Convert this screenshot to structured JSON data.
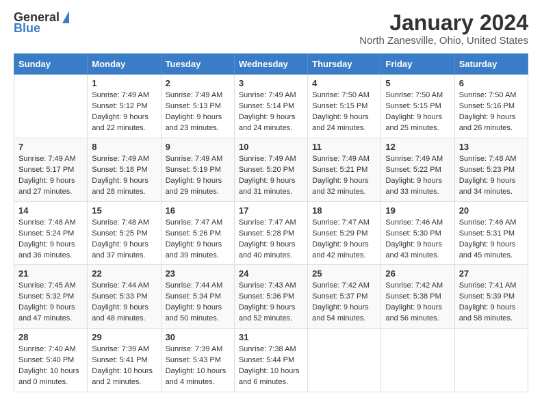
{
  "logo": {
    "general": "General",
    "blue": "Blue"
  },
  "title": "January 2024",
  "location": "North Zanesville, Ohio, United States",
  "days_of_week": [
    "Sunday",
    "Monday",
    "Tuesday",
    "Wednesday",
    "Thursday",
    "Friday",
    "Saturday"
  ],
  "weeks": [
    [
      {
        "day": "",
        "details": ""
      },
      {
        "day": "1",
        "details": "Sunrise: 7:49 AM\nSunset: 5:12 PM\nDaylight: 9 hours\nand 22 minutes."
      },
      {
        "day": "2",
        "details": "Sunrise: 7:49 AM\nSunset: 5:13 PM\nDaylight: 9 hours\nand 23 minutes."
      },
      {
        "day": "3",
        "details": "Sunrise: 7:49 AM\nSunset: 5:14 PM\nDaylight: 9 hours\nand 24 minutes."
      },
      {
        "day": "4",
        "details": "Sunrise: 7:50 AM\nSunset: 5:15 PM\nDaylight: 9 hours\nand 24 minutes."
      },
      {
        "day": "5",
        "details": "Sunrise: 7:50 AM\nSunset: 5:15 PM\nDaylight: 9 hours\nand 25 minutes."
      },
      {
        "day": "6",
        "details": "Sunrise: 7:50 AM\nSunset: 5:16 PM\nDaylight: 9 hours\nand 26 minutes."
      }
    ],
    [
      {
        "day": "7",
        "details": "Sunrise: 7:49 AM\nSunset: 5:17 PM\nDaylight: 9 hours\nand 27 minutes."
      },
      {
        "day": "8",
        "details": "Sunrise: 7:49 AM\nSunset: 5:18 PM\nDaylight: 9 hours\nand 28 minutes."
      },
      {
        "day": "9",
        "details": "Sunrise: 7:49 AM\nSunset: 5:19 PM\nDaylight: 9 hours\nand 29 minutes."
      },
      {
        "day": "10",
        "details": "Sunrise: 7:49 AM\nSunset: 5:20 PM\nDaylight: 9 hours\nand 31 minutes."
      },
      {
        "day": "11",
        "details": "Sunrise: 7:49 AM\nSunset: 5:21 PM\nDaylight: 9 hours\nand 32 minutes."
      },
      {
        "day": "12",
        "details": "Sunrise: 7:49 AM\nSunset: 5:22 PM\nDaylight: 9 hours\nand 33 minutes."
      },
      {
        "day": "13",
        "details": "Sunrise: 7:48 AM\nSunset: 5:23 PM\nDaylight: 9 hours\nand 34 minutes."
      }
    ],
    [
      {
        "day": "14",
        "details": "Sunrise: 7:48 AM\nSunset: 5:24 PM\nDaylight: 9 hours\nand 36 minutes."
      },
      {
        "day": "15",
        "details": "Sunrise: 7:48 AM\nSunset: 5:25 PM\nDaylight: 9 hours\nand 37 minutes."
      },
      {
        "day": "16",
        "details": "Sunrise: 7:47 AM\nSunset: 5:26 PM\nDaylight: 9 hours\nand 39 minutes."
      },
      {
        "day": "17",
        "details": "Sunrise: 7:47 AM\nSunset: 5:28 PM\nDaylight: 9 hours\nand 40 minutes."
      },
      {
        "day": "18",
        "details": "Sunrise: 7:47 AM\nSunset: 5:29 PM\nDaylight: 9 hours\nand 42 minutes."
      },
      {
        "day": "19",
        "details": "Sunrise: 7:46 AM\nSunset: 5:30 PM\nDaylight: 9 hours\nand 43 minutes."
      },
      {
        "day": "20",
        "details": "Sunrise: 7:46 AM\nSunset: 5:31 PM\nDaylight: 9 hours\nand 45 minutes."
      }
    ],
    [
      {
        "day": "21",
        "details": "Sunrise: 7:45 AM\nSunset: 5:32 PM\nDaylight: 9 hours\nand 47 minutes."
      },
      {
        "day": "22",
        "details": "Sunrise: 7:44 AM\nSunset: 5:33 PM\nDaylight: 9 hours\nand 48 minutes."
      },
      {
        "day": "23",
        "details": "Sunrise: 7:44 AM\nSunset: 5:34 PM\nDaylight: 9 hours\nand 50 minutes."
      },
      {
        "day": "24",
        "details": "Sunrise: 7:43 AM\nSunset: 5:36 PM\nDaylight: 9 hours\nand 52 minutes."
      },
      {
        "day": "25",
        "details": "Sunrise: 7:42 AM\nSunset: 5:37 PM\nDaylight: 9 hours\nand 54 minutes."
      },
      {
        "day": "26",
        "details": "Sunrise: 7:42 AM\nSunset: 5:38 PM\nDaylight: 9 hours\nand 56 minutes."
      },
      {
        "day": "27",
        "details": "Sunrise: 7:41 AM\nSunset: 5:39 PM\nDaylight: 9 hours\nand 58 minutes."
      }
    ],
    [
      {
        "day": "28",
        "details": "Sunrise: 7:40 AM\nSunset: 5:40 PM\nDaylight: 10 hours\nand 0 minutes."
      },
      {
        "day": "29",
        "details": "Sunrise: 7:39 AM\nSunset: 5:41 PM\nDaylight: 10 hours\nand 2 minutes."
      },
      {
        "day": "30",
        "details": "Sunrise: 7:39 AM\nSunset: 5:43 PM\nDaylight: 10 hours\nand 4 minutes."
      },
      {
        "day": "31",
        "details": "Sunrise: 7:38 AM\nSunset: 5:44 PM\nDaylight: 10 hours\nand 6 minutes."
      },
      {
        "day": "",
        "details": ""
      },
      {
        "day": "",
        "details": ""
      },
      {
        "day": "",
        "details": ""
      }
    ]
  ]
}
